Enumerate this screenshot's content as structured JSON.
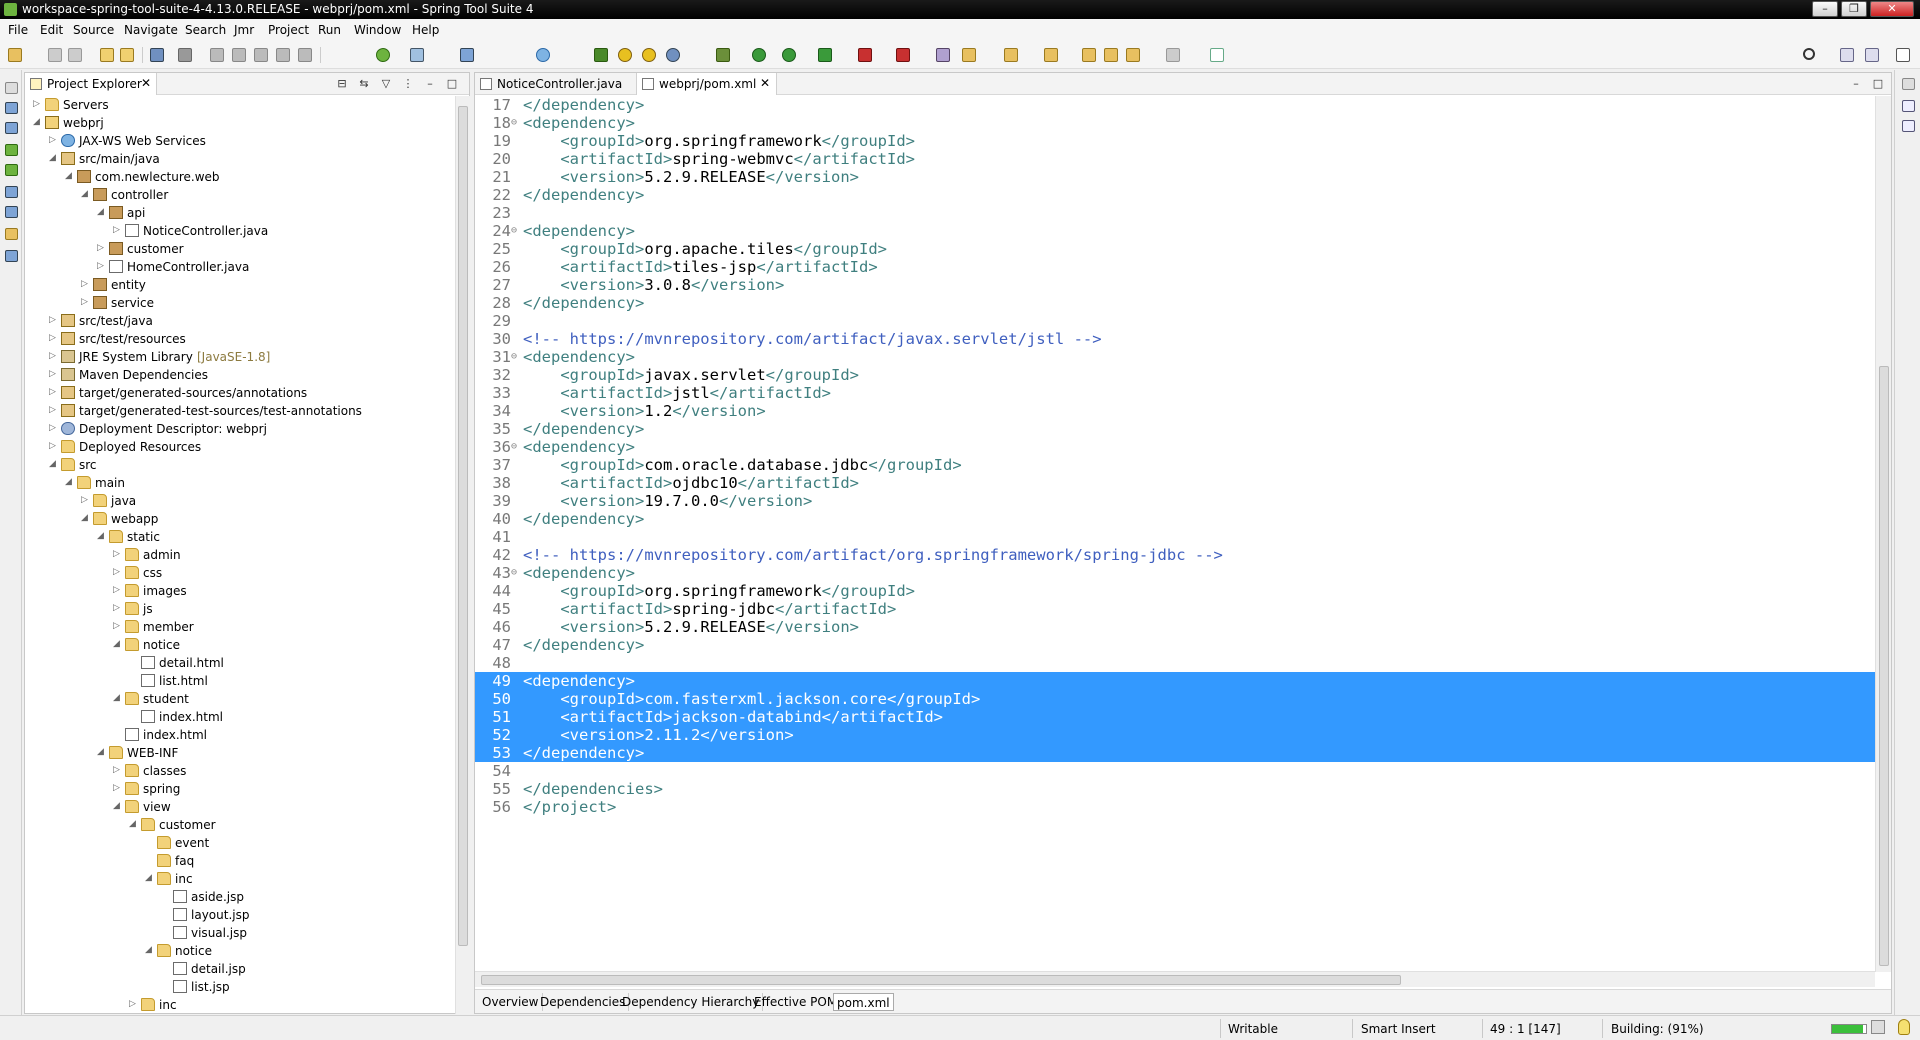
{
  "window": {
    "title": "workspace-spring-tool-suite-4-4.13.0.RELEASE - webprj/pom.xml - Spring Tool Suite 4",
    "controls": [
      "–",
      "❐",
      "✕"
    ]
  },
  "menu": [
    "File",
    "Edit",
    "Source",
    "Navigate",
    "Search",
    "Jmr",
    "Project",
    "Run",
    "Window",
    "Help"
  ],
  "explorer": {
    "tab_label": "Project Explorer",
    "close": "✕",
    "tree": [
      {
        "label": "Servers",
        "level": 0,
        "state": "collapsed",
        "icon": "folder"
      },
      {
        "label": "webprj",
        "level": 0,
        "state": "expanded",
        "icon": "project"
      },
      {
        "label": "JAX-WS Web Services",
        "level": 1,
        "state": "collapsed",
        "icon": "globe"
      },
      {
        "label": "src/main/java",
        "level": 1,
        "state": "expanded",
        "icon": "srcfolder"
      },
      {
        "label": "com.newlecture.web",
        "level": 2,
        "state": "expanded",
        "icon": "pkg"
      },
      {
        "label": "controller",
        "level": 3,
        "state": "expanded",
        "icon": "pkg"
      },
      {
        "label": "api",
        "level": 4,
        "state": "expanded",
        "icon": "pkg"
      },
      {
        "label": "NoticeController.java",
        "level": 5,
        "state": "collapsed",
        "icon": "java"
      },
      {
        "label": "customer",
        "level": 4,
        "state": "collapsed",
        "icon": "pkg"
      },
      {
        "label": "HomeController.java",
        "level": 4,
        "state": "collapsed",
        "icon": "java"
      },
      {
        "label": "entity",
        "level": 3,
        "state": "collapsed",
        "icon": "pkg"
      },
      {
        "label": "service",
        "level": 3,
        "state": "collapsed",
        "icon": "pkg"
      },
      {
        "label": "src/test/java",
        "level": 1,
        "state": "collapsed",
        "icon": "srcfolder"
      },
      {
        "label": "src/test/resources",
        "level": 1,
        "state": "collapsed",
        "icon": "srcfolder"
      },
      {
        "label": "JRE System Library",
        "deco": "[JavaSE-1.8]",
        "level": 1,
        "state": "collapsed",
        "icon": "lib"
      },
      {
        "label": "Maven Dependencies",
        "level": 1,
        "state": "collapsed",
        "icon": "lib"
      },
      {
        "label": "target/generated-sources/annotations",
        "level": 1,
        "state": "collapsed",
        "icon": "srcfolder"
      },
      {
        "label": "target/generated-test-sources/test-annotations",
        "level": 1,
        "state": "collapsed",
        "icon": "srcfolder"
      },
      {
        "label": "Deployment Descriptor: webprj",
        "level": 1,
        "state": "collapsed",
        "icon": "gear"
      },
      {
        "label": "Deployed Resources",
        "level": 1,
        "state": "collapsed",
        "icon": "folder"
      },
      {
        "label": "src",
        "level": 1,
        "state": "expanded",
        "icon": "folder"
      },
      {
        "label": "main",
        "level": 2,
        "state": "expanded",
        "icon": "folder"
      },
      {
        "label": "java",
        "level": 3,
        "state": "collapsed",
        "icon": "folder"
      },
      {
        "label": "webapp",
        "level": 3,
        "state": "expanded",
        "icon": "folder"
      },
      {
        "label": "static",
        "level": 4,
        "state": "expanded",
        "icon": "folder"
      },
      {
        "label": "admin",
        "level": 5,
        "state": "collapsed",
        "icon": "folder"
      },
      {
        "label": "css",
        "level": 5,
        "state": "collapsed",
        "icon": "folder"
      },
      {
        "label": "images",
        "level": 5,
        "state": "collapsed",
        "icon": "folder"
      },
      {
        "label": "js",
        "level": 5,
        "state": "collapsed",
        "icon": "folder"
      },
      {
        "label": "member",
        "level": 5,
        "state": "collapsed",
        "icon": "folder"
      },
      {
        "label": "notice",
        "level": 5,
        "state": "expanded",
        "icon": "folder"
      },
      {
        "label": "detail.html",
        "level": 6,
        "state": "leaf",
        "icon": "html"
      },
      {
        "label": "list.html",
        "level": 6,
        "state": "leaf",
        "icon": "html"
      },
      {
        "label": "student",
        "level": 5,
        "state": "expanded",
        "icon": "folder"
      },
      {
        "label": "index.html",
        "level": 6,
        "state": "leaf",
        "icon": "html"
      },
      {
        "label": "index.html",
        "level": 5,
        "state": "leaf",
        "icon": "html"
      },
      {
        "label": "WEB-INF",
        "level": 4,
        "state": "expanded",
        "icon": "folder"
      },
      {
        "label": "classes",
        "level": 5,
        "state": "collapsed",
        "icon": "folder"
      },
      {
        "label": "spring",
        "level": 5,
        "state": "collapsed",
        "icon": "folder"
      },
      {
        "label": "view",
        "level": 5,
        "state": "expanded",
        "icon": "folder"
      },
      {
        "label": "customer",
        "level": 6,
        "state": "expanded",
        "icon": "folder"
      },
      {
        "label": "event",
        "level": 7,
        "state": "leaf",
        "icon": "folder"
      },
      {
        "label": "faq",
        "level": 7,
        "state": "leaf",
        "icon": "folder"
      },
      {
        "label": "inc",
        "level": 7,
        "state": "expanded",
        "icon": "folder"
      },
      {
        "label": "aside.jsp",
        "level": 8,
        "state": "leaf",
        "icon": "html"
      },
      {
        "label": "layout.jsp",
        "level": 8,
        "state": "leaf",
        "icon": "html"
      },
      {
        "label": "visual.jsp",
        "level": 8,
        "state": "leaf",
        "icon": "html"
      },
      {
        "label": "notice",
        "level": 7,
        "state": "expanded",
        "icon": "folder"
      },
      {
        "label": "detail.jsp",
        "level": 8,
        "state": "leaf",
        "icon": "html"
      },
      {
        "label": "list.jsp",
        "level": 8,
        "state": "leaf",
        "icon": "html"
      },
      {
        "label": "inc",
        "level": 6,
        "state": "collapsed",
        "icon": "folder"
      }
    ]
  },
  "editor": {
    "tabs": [
      {
        "label": "NoticeController.java",
        "active": false
      },
      {
        "label": "webprj/pom.xml",
        "active": true
      }
    ],
    "lines": [
      {
        "n": "17",
        "fold": "",
        "indent": 0,
        "kind": "close",
        "name": "dependency"
      },
      {
        "n": "18",
        "fold": "⊖",
        "indent": 0,
        "kind": "open",
        "name": "dependency"
      },
      {
        "n": "19",
        "fold": "",
        "indent": 1,
        "kind": "el",
        "name": "groupId",
        "value": "org.springframework"
      },
      {
        "n": "20",
        "fold": "",
        "indent": 1,
        "kind": "el",
        "name": "artifactId",
        "value": "spring-webmvc"
      },
      {
        "n": "21",
        "fold": "",
        "indent": 1,
        "kind": "el",
        "name": "version",
        "value": "5.2.9.RELEASE"
      },
      {
        "n": "22",
        "fold": "",
        "indent": 0,
        "kind": "close",
        "name": "dependency"
      },
      {
        "n": "23",
        "fold": "",
        "indent": 0,
        "kind": "blank"
      },
      {
        "n": "24",
        "fold": "⊖",
        "indent": 0,
        "kind": "open",
        "name": "dependency"
      },
      {
        "n": "25",
        "fold": "",
        "indent": 1,
        "kind": "el",
        "name": "groupId",
        "value": "org.apache.tiles"
      },
      {
        "n": "26",
        "fold": "",
        "indent": 1,
        "kind": "el",
        "name": "artifactId",
        "value": "tiles-jsp"
      },
      {
        "n": "27",
        "fold": "",
        "indent": 1,
        "kind": "el",
        "name": "version",
        "value": "3.0.8"
      },
      {
        "n": "28",
        "fold": "",
        "indent": 0,
        "kind": "close",
        "name": "dependency"
      },
      {
        "n": "29",
        "fold": "",
        "indent": 0,
        "kind": "blank"
      },
      {
        "n": "30",
        "fold": "",
        "indent": 0,
        "kind": "comment",
        "value": "<!-- https://mvnrepository.com/artifact/javax.servlet/jstl -->"
      },
      {
        "n": "31",
        "fold": "⊖",
        "indent": 0,
        "kind": "open",
        "name": "dependency"
      },
      {
        "n": "32",
        "fold": "",
        "indent": 1,
        "kind": "el",
        "name": "groupId",
        "value": "javax.servlet"
      },
      {
        "n": "33",
        "fold": "",
        "indent": 1,
        "kind": "el",
        "name": "artifactId",
        "value": "jstl"
      },
      {
        "n": "34",
        "fold": "",
        "indent": 1,
        "kind": "el",
        "name": "version",
        "value": "1.2"
      },
      {
        "n": "35",
        "fold": "",
        "indent": 0,
        "kind": "close",
        "name": "dependency"
      },
      {
        "n": "36",
        "fold": "⊖",
        "indent": 0,
        "kind": "open",
        "name": "dependency"
      },
      {
        "n": "37",
        "fold": "",
        "indent": 1,
        "kind": "el",
        "name": "groupId",
        "value": "com.oracle.database.jdbc"
      },
      {
        "n": "38",
        "fold": "",
        "indent": 1,
        "kind": "el",
        "name": "artifactId",
        "value": "ojdbc10"
      },
      {
        "n": "39",
        "fold": "",
        "indent": 1,
        "kind": "el",
        "name": "version",
        "value": "19.7.0.0"
      },
      {
        "n": "40",
        "fold": "",
        "indent": 0,
        "kind": "close",
        "name": "dependency"
      },
      {
        "n": "41",
        "fold": "",
        "indent": 0,
        "kind": "blank"
      },
      {
        "n": "42",
        "fold": "",
        "indent": 0,
        "kind": "comment",
        "value": "<!-- https://mvnrepository.com/artifact/org.springframework/spring-jdbc -->"
      },
      {
        "n": "43",
        "fold": "⊖",
        "indent": 0,
        "kind": "open",
        "name": "dependency"
      },
      {
        "n": "44",
        "fold": "",
        "indent": 1,
        "kind": "el",
        "name": "groupId",
        "value": "org.springframework"
      },
      {
        "n": "45",
        "fold": "",
        "indent": 1,
        "kind": "el",
        "name": "artifactId",
        "value": "spring-jdbc"
      },
      {
        "n": "46",
        "fold": "",
        "indent": 1,
        "kind": "el",
        "name": "version",
        "value": "5.2.9.RELEASE"
      },
      {
        "n": "47",
        "fold": "",
        "indent": 0,
        "kind": "close",
        "name": "dependency"
      },
      {
        "n": "48",
        "fold": "",
        "indent": 0,
        "kind": "blank"
      },
      {
        "n": "49",
        "fold": "",
        "indent": 0,
        "kind": "open",
        "name": "dependency",
        "selected": true
      },
      {
        "n": "50",
        "fold": "",
        "indent": 1,
        "kind": "el",
        "name": "groupId",
        "value": "com.fasterxml.jackson.core",
        "selected": true
      },
      {
        "n": "51",
        "fold": "",
        "indent": 1,
        "kind": "el",
        "name": "artifactId",
        "value": "jackson-databind",
        "selected": true
      },
      {
        "n": "52",
        "fold": "",
        "indent": 1,
        "kind": "el",
        "name": "version",
        "value": "2.11.2",
        "selected": true
      },
      {
        "n": "53",
        "fold": "",
        "indent": 0,
        "kind": "close",
        "name": "dependency",
        "selected": true
      },
      {
        "n": "54",
        "fold": "",
        "indent": 0,
        "kind": "blank"
      },
      {
        "n": "55",
        "fold": "",
        "indent": 0,
        "kind": "close",
        "name": "dependencies"
      },
      {
        "n": "56",
        "fold": "",
        "indent": 0,
        "kind": "close",
        "name": "project"
      }
    ],
    "bottom_tabs": [
      "Overview",
      "Dependencies",
      "Dependency Hierarchy",
      "Effective POM",
      "pom.xml"
    ],
    "active_bottom_tab": "pom.xml"
  },
  "status": {
    "writable": "Writable",
    "insert_mode": "Smart Insert",
    "position": "49 : 1 [147]",
    "build": "Building: (91%)",
    "build_progress": 0.91
  },
  "colors": {
    "selection": "#3399ff",
    "tag": "#3f7f7f",
    "comment": "#3f5fbf",
    "line_number": "#787878"
  }
}
